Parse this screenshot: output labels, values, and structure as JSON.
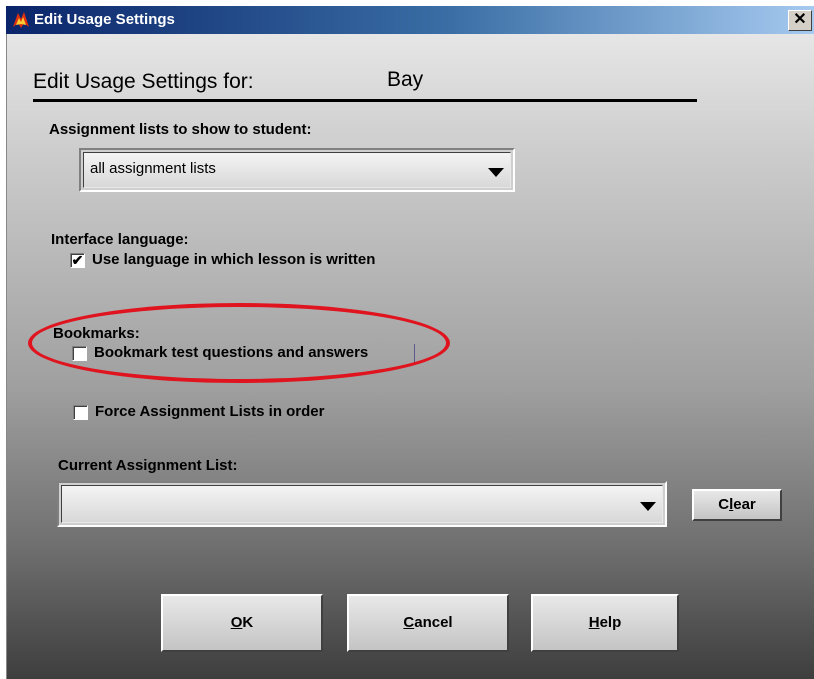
{
  "window": {
    "title": "Edit Usage Settings",
    "close_symbol": "✕"
  },
  "header": {
    "label": "Edit Usage Settings for:",
    "student_name": "Bay"
  },
  "assignment_lists": {
    "label": "Assignment lists to show to student:",
    "selected": "all assignment lists"
  },
  "interface_language": {
    "label": "Interface language:",
    "checkbox_label": "Use language in which lesson is written",
    "checked": true,
    "check_mark": "✔"
  },
  "bookmarks": {
    "label": "Bookmarks:",
    "checkbox_label": "Bookmark test questions and answers",
    "checked": false
  },
  "force_order": {
    "checkbox_label": "Force Assignment Lists in order",
    "checked": false
  },
  "current_assignment": {
    "label": "Current Assignment List:",
    "selected": "",
    "clear_button_prefix": "C",
    "clear_button_mnemonic": "l",
    "clear_button_suffix": "ear"
  },
  "buttons": {
    "ok_mnemonic": "O",
    "ok_rest": "K",
    "cancel_mnemonic": "C",
    "cancel_rest": "ancel",
    "help_mnemonic": "H",
    "help_rest": "elp"
  },
  "annotation": {
    "highlight_color": "#e0141e"
  }
}
